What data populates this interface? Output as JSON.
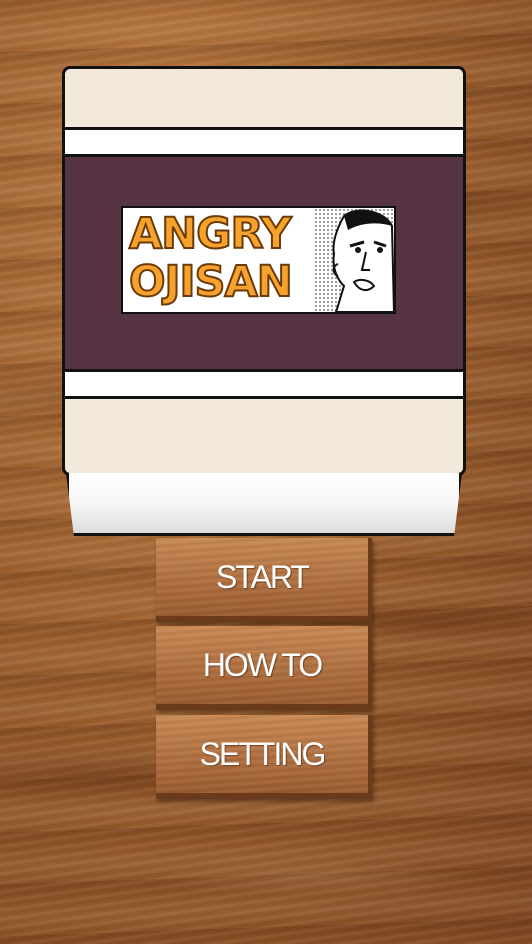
{
  "logo": {
    "line1": "ANGRY",
    "line2": "OJISAN",
    "image": "angry-man-face-icon",
    "colors": {
      "text": "#f7a22c",
      "outline": "#6a3a08"
    }
  },
  "menu": {
    "items": [
      {
        "id": "start",
        "label": "START"
      },
      {
        "id": "howto",
        "label": "HOW TO"
      },
      {
        "id": "setting",
        "label": "SETTING"
      }
    ]
  },
  "colors": {
    "jar_band": "#573443",
    "jar_body": "#f3e9db",
    "wood_button": "#b07040",
    "background_wood": "#9c5e2c"
  }
}
